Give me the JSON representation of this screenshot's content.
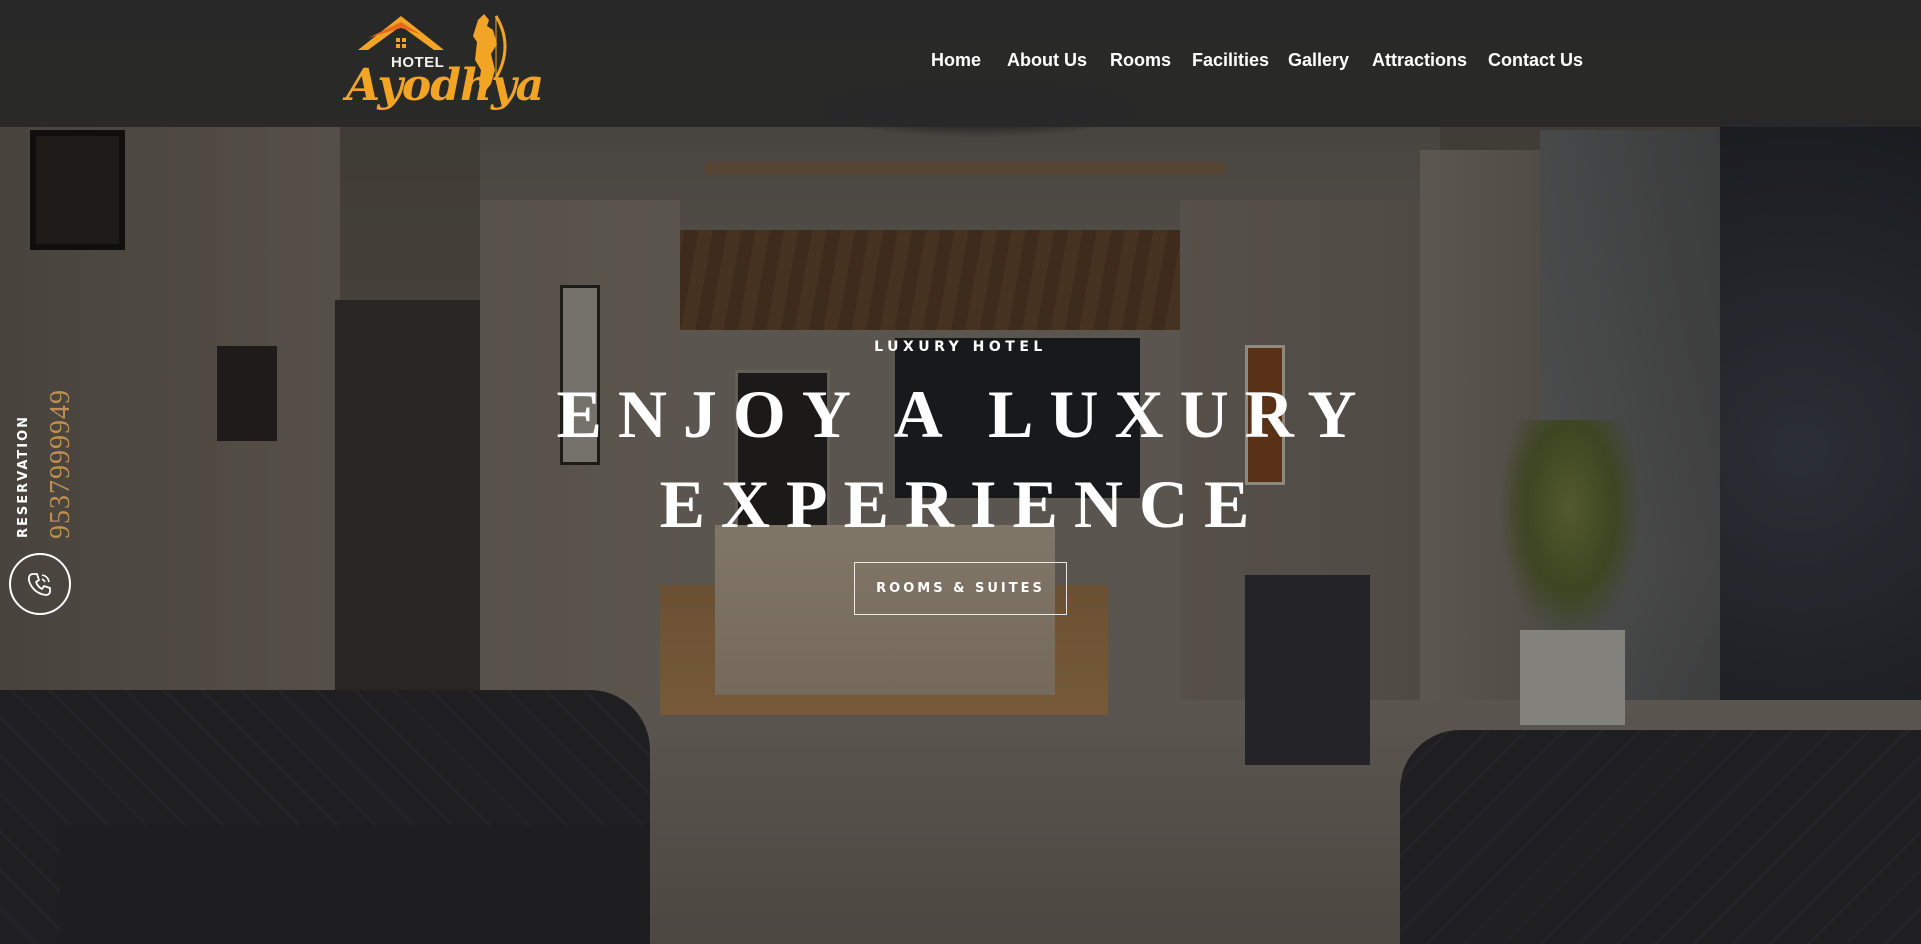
{
  "brand": {
    "logo_small": "HOTEL",
    "logo_name": "Ayodhya"
  },
  "nav": {
    "items": [
      {
        "label": "Home"
      },
      {
        "label": "About Us"
      },
      {
        "label": "Rooms"
      },
      {
        "label": "Facilities"
      },
      {
        "label": "Gallery"
      },
      {
        "label": "Attractions"
      },
      {
        "label": "Contact Us"
      }
    ]
  },
  "hero": {
    "eyebrow": "LUXURY HOTEL",
    "headline_line1": "ENJOY A LUXURY",
    "headline_line2": "EXPERIENCE",
    "cta_label": "ROOMS & SUITES"
  },
  "reservation": {
    "label": "RESERVATION",
    "phone": "9537999949",
    "icon": "phone-call-icon"
  },
  "colors": {
    "header_bg": "#282828",
    "accent_gold": "#c08f50",
    "logo_orange": "#f2a425",
    "text": "#ffffff"
  }
}
